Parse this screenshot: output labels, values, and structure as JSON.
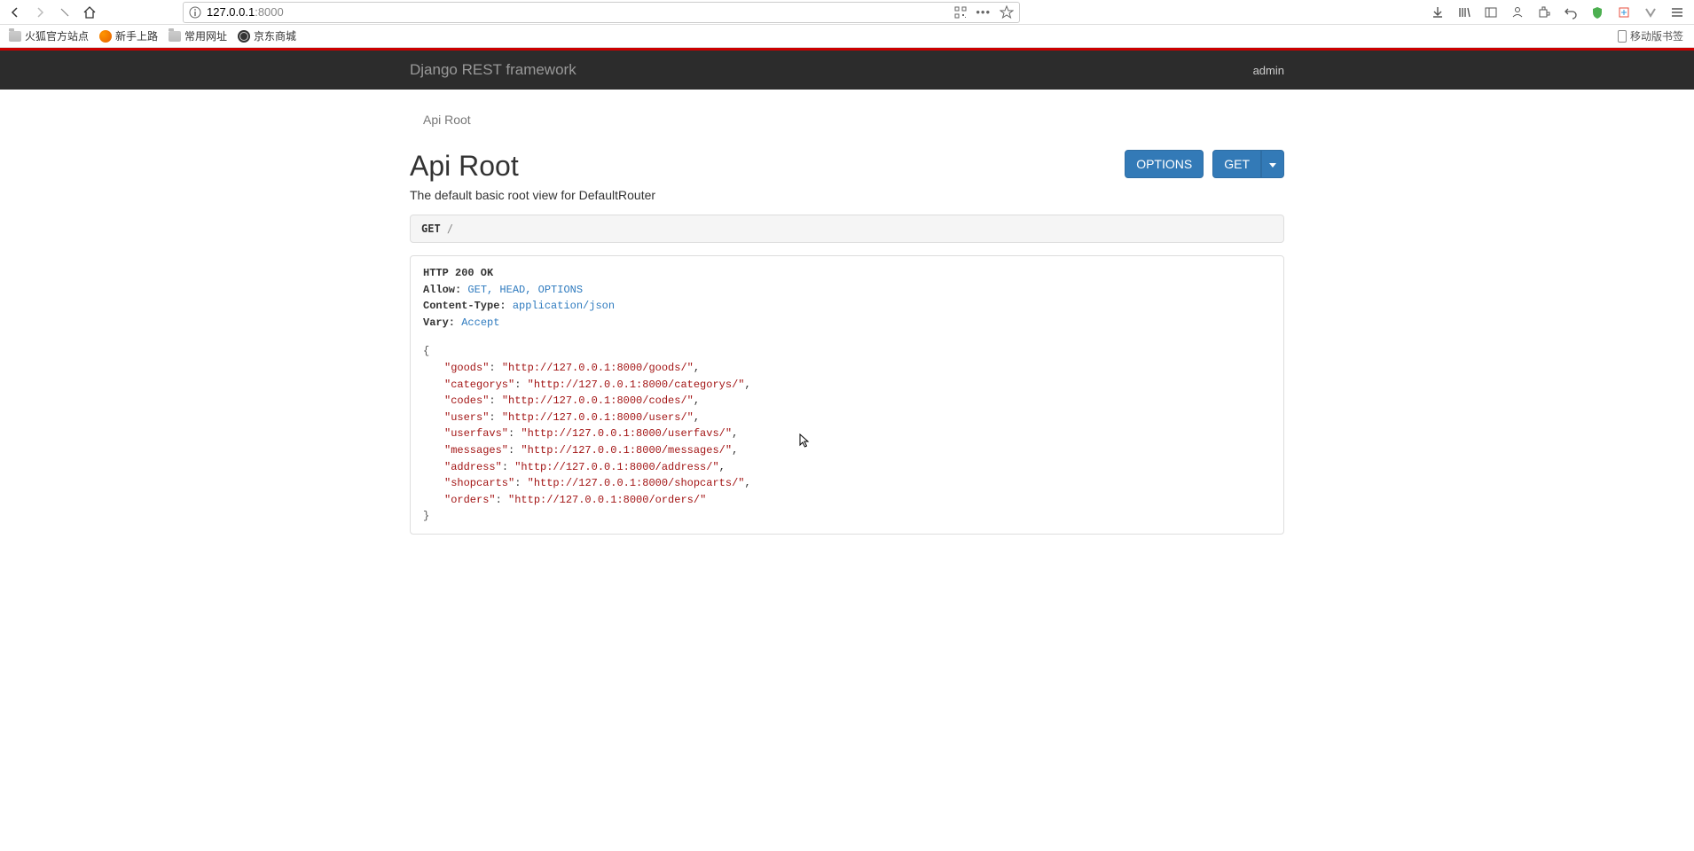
{
  "browser": {
    "url_host": "127.0.0.1",
    "url_port": ":8000"
  },
  "bookmarks": {
    "items": [
      {
        "label": "火狐官方站点",
        "icon": "folder"
      },
      {
        "label": "新手上路",
        "icon": "ff"
      },
      {
        "label": "常用网址",
        "icon": "folder"
      },
      {
        "label": "京东商城",
        "icon": "jd"
      }
    ],
    "mobile_label": "移动版书签"
  },
  "drf": {
    "brand": "Django REST framework",
    "user": "admin",
    "breadcrumb": "Api Root",
    "title": "Api Root",
    "subtitle": "The default basic root view for DefaultRouter",
    "btn_options": "OPTIONS",
    "btn_get": "GET",
    "request": {
      "method": "GET",
      "path": "/"
    },
    "response": {
      "status": "HTTP 200 OK",
      "headers": [
        {
          "name": "Allow:",
          "value": "GET, HEAD, OPTIONS"
        },
        {
          "name": "Content-Type:",
          "value": "application/json"
        },
        {
          "name": "Vary:",
          "value": "Accept"
        }
      ],
      "body": [
        {
          "key": "goods",
          "value": "http://127.0.0.1:8000/goods/"
        },
        {
          "key": "categorys",
          "value": "http://127.0.0.1:8000/categorys/"
        },
        {
          "key": "codes",
          "value": "http://127.0.0.1:8000/codes/"
        },
        {
          "key": "users",
          "value": "http://127.0.0.1:8000/users/"
        },
        {
          "key": "userfavs",
          "value": "http://127.0.0.1:8000/userfavs/"
        },
        {
          "key": "messages",
          "value": "http://127.0.0.1:8000/messages/"
        },
        {
          "key": "address",
          "value": "http://127.0.0.1:8000/address/"
        },
        {
          "key": "shopcarts",
          "value": "http://127.0.0.1:8000/shopcarts/"
        },
        {
          "key": "orders",
          "value": "http://127.0.0.1:8000/orders/"
        }
      ]
    }
  }
}
